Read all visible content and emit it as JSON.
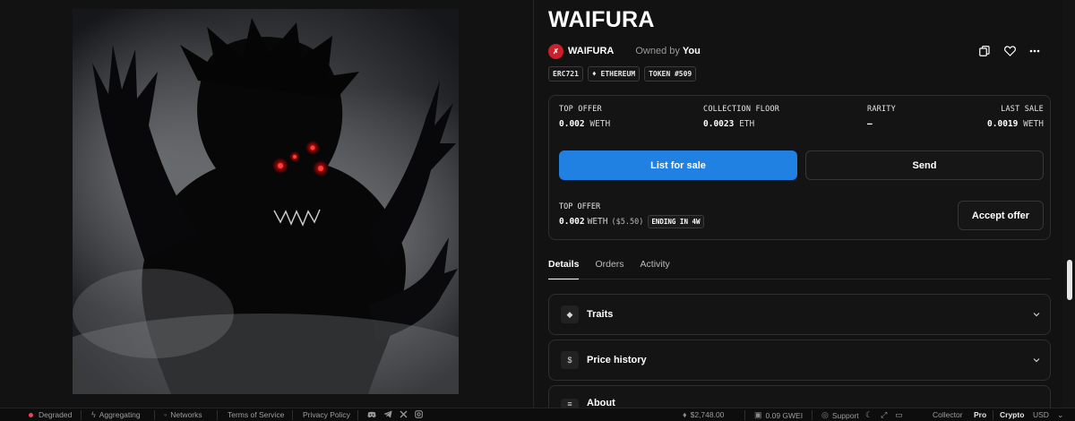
{
  "item": {
    "title": "WAIFURA",
    "collection_name": "WAIFURA",
    "collection_avatar_glyph": "✗",
    "owned_by_label": "Owned by",
    "owner": "You",
    "chips": [
      "ERC721",
      "♦ ETHEREUM",
      "TOKEN #509"
    ]
  },
  "actions": {
    "icons": [
      "copy-icon",
      "heart-icon",
      "more-icon"
    ]
  },
  "stats": [
    {
      "label": "TOP OFFER",
      "value": "0.002",
      "unit": "WETH"
    },
    {
      "label": "COLLECTION FLOOR",
      "value": "0.0023",
      "unit": "ETH"
    },
    {
      "label": "RARITY",
      "value": "–",
      "unit": ""
    },
    {
      "label": "LAST SALE",
      "value": "0.0019",
      "unit": "WETH"
    }
  ],
  "buttons": {
    "list_for_sale": "List for sale",
    "send": "Send",
    "accept_offer": "Accept offer"
  },
  "top_offer": {
    "label": "TOP OFFER",
    "value": "0.002",
    "unit": "WETH",
    "usd": "($5.50)",
    "ending": "ENDING IN 4W"
  },
  "tabs": [
    "Details",
    "Orders",
    "Activity"
  ],
  "accordions": [
    {
      "label": "Traits",
      "icon": "◆"
    },
    {
      "label": "Price history",
      "icon": "$"
    },
    {
      "label": "About",
      "icon": "≡"
    }
  ],
  "status_bar": {
    "degraded": "Degraded",
    "aggregating": "Aggregating",
    "networks": "Networks",
    "terms": "Terms of Service",
    "privacy": "Privacy Policy",
    "eth_price": "$2,748.00",
    "gas": "0.09 GWEI",
    "support": "Support",
    "collector": "Collector",
    "pro": "Pro",
    "crypto": "Crypto",
    "usd": "USD"
  },
  "colors": {
    "accent": "#2081e2",
    "background": "#121212",
    "brand_red": "#c8212b",
    "status_red": "#e5484d"
  }
}
